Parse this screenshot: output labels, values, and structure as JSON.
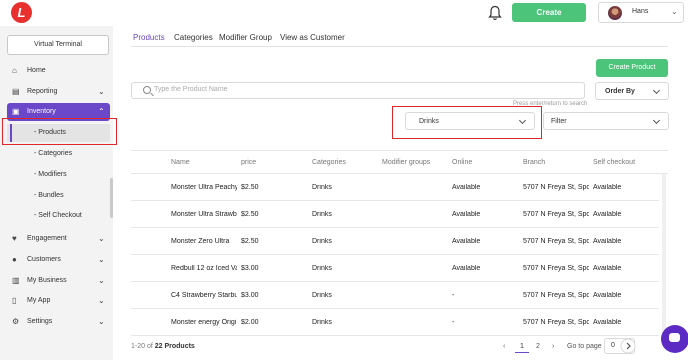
{
  "topbar": {
    "logo_text": "L",
    "create_label": "Create",
    "user_name": "Hans",
    "accent": "#4cc47a"
  },
  "sidebar": {
    "virtual_terminal": "Virtual Terminal",
    "items": [
      {
        "label": "Home",
        "icon": "home-icon"
      },
      {
        "label": "Reporting",
        "icon": "report-icon"
      },
      {
        "label": "Inventory",
        "icon": "inventory-icon",
        "active": true
      },
      {
        "label": "Engagement",
        "icon": "engagement-icon"
      },
      {
        "label": "Customers",
        "icon": "customers-icon"
      },
      {
        "label": "My Business",
        "icon": "business-icon"
      },
      {
        "label": "My App",
        "icon": "app-icon"
      },
      {
        "label": "Settings",
        "icon": "settings-icon"
      }
    ],
    "sub_items": [
      "- Products",
      "- Categories",
      "- Modifiers",
      "- Bundles",
      "- Self Checkout"
    ],
    "active_color": "#6b47c9"
  },
  "tabs": [
    "Products",
    "Categories",
    "Modifier Group",
    "View as Customer"
  ],
  "toolbar": {
    "create_product": "Create Product",
    "search_placeholder": "Type the Product Name",
    "order_by": "Order By",
    "hint": "Press enter/return to search",
    "category_value": "Drinks",
    "filter_label": "Filter"
  },
  "table": {
    "headers": [
      "Name",
      "price",
      "Categories",
      "Modifier groups",
      "Online",
      "Branch",
      "Self checkout"
    ],
    "rows": [
      [
        "Monster Ultra Peachy",
        "$2.50",
        "Drinks",
        "",
        "Available",
        "5707 N Freya St, Spok",
        "Available"
      ],
      [
        "Monster Ultra Strawb",
        "$2.50",
        "Drinks",
        "",
        "Available",
        "5707 N Freya St, Spok",
        "Available"
      ],
      [
        "Monster Zero Ultra",
        "$2.50",
        "Drinks",
        "",
        "Available",
        "5707 N Freya St, Spok",
        "Available"
      ],
      [
        "Redbull 12 oz Iced Va",
        "$3.00",
        "Drinks",
        "",
        "Available",
        "5707 N Freya St, Spok",
        "Available"
      ],
      [
        "C4 Strawberry Starbu",
        "$3.00",
        "Drinks",
        "",
        "-",
        "5707 N Freya St, Spok",
        "Available"
      ],
      [
        "Monster energy Origi",
        "$2.00",
        "Drinks",
        "",
        "-",
        "5707 N Freya St, Spok",
        "Available"
      ]
    ]
  },
  "footer": {
    "range": "1-20 of ",
    "total": "22 Products",
    "pages": [
      "1",
      "2"
    ],
    "goto_label": "Go to page",
    "goto_value": "0"
  }
}
